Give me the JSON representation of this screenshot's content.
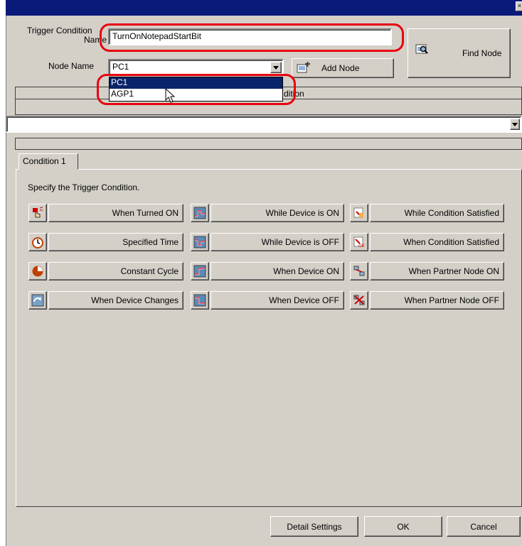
{
  "form": {
    "trigger_label_line1": "Trigger Condition",
    "trigger_label_line2": "Name",
    "trigger_value": "TurnOnNotepadStartBit",
    "node_label": "Node Name",
    "node_value": "PC1",
    "add_node": "Add Node",
    "find_node": "Find Node",
    "dropdown_options": [
      "PC1",
      "AGP1"
    ],
    "header_fragment": "dition"
  },
  "tab": {
    "label": "Condition 1"
  },
  "instruction": "Specify the Trigger Condition.",
  "conditions": [
    [
      "When Turned ON",
      "While Device is ON",
      "While Condition Satisfied"
    ],
    [
      "Specified Time",
      "While Device is OFF",
      "When Condition Satisfied"
    ],
    [
      "Constant Cycle",
      "When Device ON",
      "When Partner Node ON"
    ],
    [
      "When Device Changes",
      "When Device OFF",
      "When Partner Node OFF"
    ]
  ],
  "footer": {
    "detail": "Detail Settings",
    "ok": "OK",
    "cancel": "Cancel"
  },
  "colors": {
    "title_bar": "#0a1a7a",
    "highlight": "#e8000f",
    "selection": "#0a246a"
  }
}
